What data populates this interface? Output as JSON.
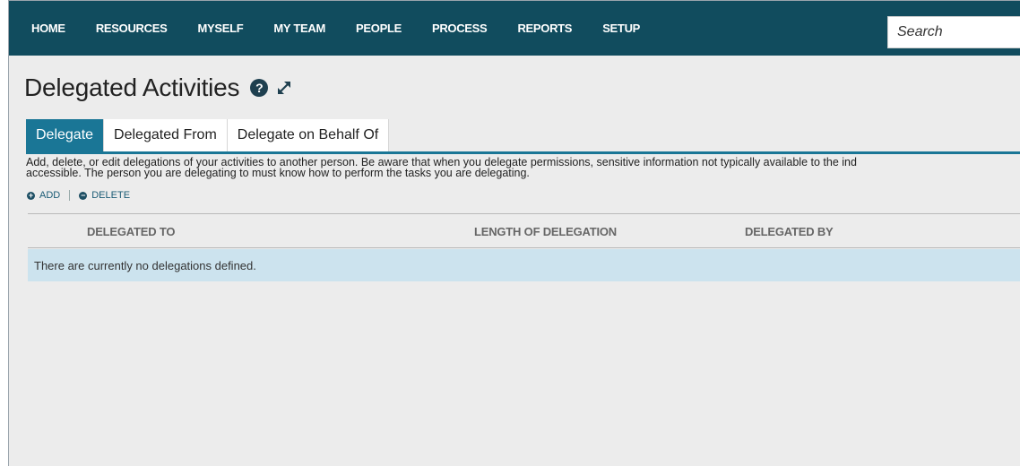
{
  "nav": {
    "items": [
      "HOME",
      "RESOURCES",
      "MYSELF",
      "MY TEAM",
      "PEOPLE",
      "PROCESS",
      "REPORTS",
      "SETUP"
    ],
    "search_placeholder": "Search"
  },
  "page": {
    "title": "Delegated Activities",
    "help_glyph": "?"
  },
  "tabs": [
    "Delegate",
    "Delegated From",
    "Delegate on Behalf Of"
  ],
  "description": {
    "line1": "Add, delete, or edit delegations of your activities to another person. Be aware that when you delegate permissions, sensitive information not typically available to the ind",
    "line2": "accessible. The person you are delegating to must know how to perform the tasks you are delegating."
  },
  "actions": {
    "add": "ADD",
    "add_glyph": "+",
    "delete": "DELETE",
    "delete_glyph": "−"
  },
  "table": {
    "columns": [
      "DELEGATED TO",
      "LENGTH OF DELEGATION",
      "DELEGATED BY"
    ],
    "empty_message": "There are currently no delegations defined."
  },
  "colors": {
    "nav_bg": "#114c5e",
    "tab_active": "#1a7696",
    "empty_row_bg": "#cce3ee"
  },
  "icons": [
    "help-icon",
    "expand-icon",
    "add-icon",
    "delete-icon"
  ]
}
